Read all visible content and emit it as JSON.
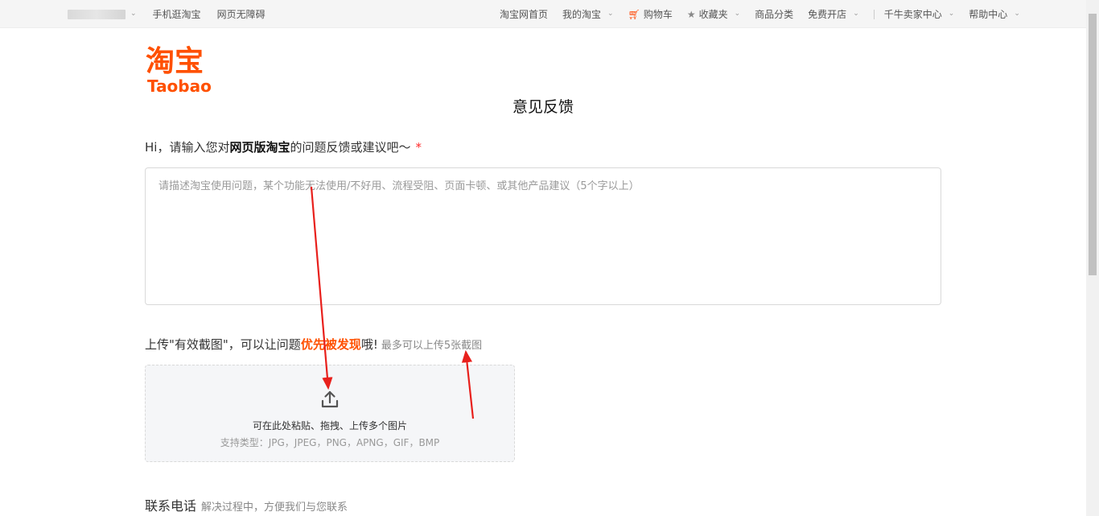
{
  "topbar": {
    "left_links": [
      "手机逛淘宝",
      "网页无障碍"
    ],
    "right_items": [
      {
        "label": "淘宝网首页",
        "dropdown": false,
        "icon": ""
      },
      {
        "label": "我的淘宝",
        "dropdown": true,
        "icon": ""
      },
      {
        "label": "购物车",
        "dropdown": false,
        "icon": "cart-icon"
      },
      {
        "label": "收藏夹",
        "dropdown": true,
        "icon": "star-icon"
      },
      {
        "label": "商品分类",
        "dropdown": false,
        "icon": ""
      },
      {
        "label": "免费开店",
        "dropdown": true,
        "icon": ""
      },
      {
        "label": "千牛卖家中心",
        "dropdown": true,
        "icon": ""
      },
      {
        "label": "帮助中心",
        "dropdown": true,
        "icon": ""
      }
    ]
  },
  "logo": {
    "cn": "淘宝",
    "en": "Taobao"
  },
  "page_title": "意见反馈",
  "question": {
    "prefix": "Hi，请输入您对",
    "emphasis": "网页版淘宝",
    "suffix": "的问题反馈或建议吧～",
    "required_mark": "*"
  },
  "feedback": {
    "placeholder": "请描述淘宝使用问题，某个功能无法使用/不好用、流程受阻、页面卡顿、或其他产品建议（5个字以上）",
    "value": ""
  },
  "upload": {
    "label_prefix": "上传\"有效截图\"，可以让问题",
    "label_emphasis": "优先被发现",
    "label_suffix": "哦!",
    "hint": "最多可以上传5张截图",
    "drop_text": "可在此处粘贴、拖拽、上传多个图片",
    "formats": "支持类型：JPG，JPEG，PNG，APNG，GIF，BMP"
  },
  "contact": {
    "label": "联系电话",
    "hint": "解决过程中，方便我们与您联系"
  },
  "colors": {
    "brand": "#ff5000",
    "required": "#ff2a2a",
    "annotation_arrow": "#e8201c"
  }
}
